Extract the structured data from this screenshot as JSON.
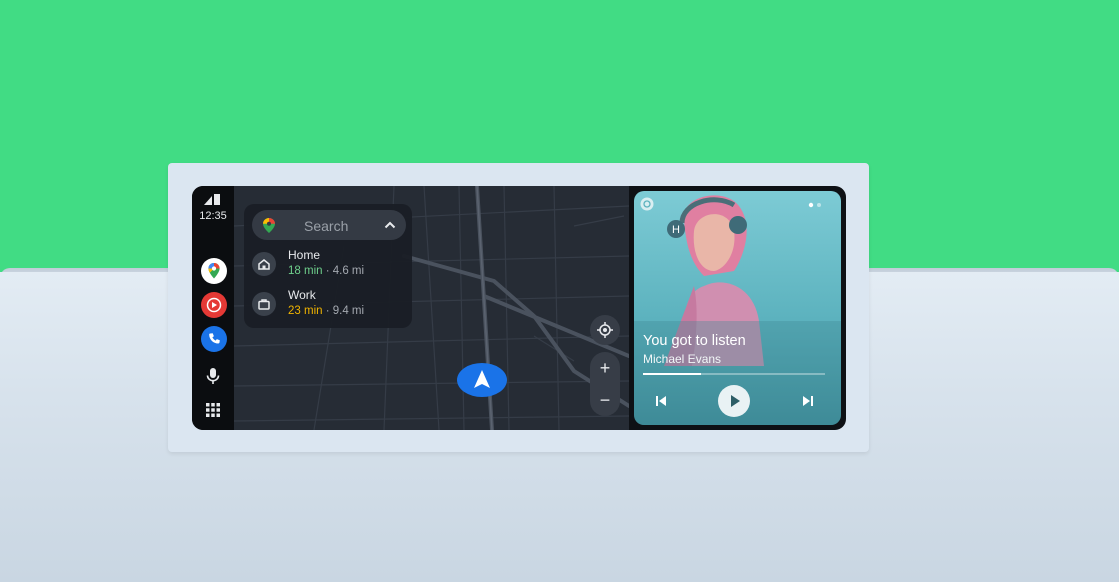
{
  "status": {
    "time": "12:35"
  },
  "rail": {
    "apps": [
      {
        "name": "Google Maps",
        "icon": "maps-icon",
        "color": "#ffffff"
      },
      {
        "name": "YouTube Music",
        "icon": "youtube-music-icon",
        "color": "#e53935"
      },
      {
        "name": "Phone",
        "icon": "phone-icon",
        "color": "#1a73e8"
      }
    ],
    "mic_icon": "microphone-icon",
    "launcher_icon": "app-grid-icon"
  },
  "nav": {
    "search_placeholder": "Search",
    "destinations": [
      {
        "name": "Home",
        "eta": "18 min",
        "distance": " · 4.6 mi",
        "eta_color": "#6fd08c",
        "icon": "home-icon"
      },
      {
        "name": "Work",
        "eta": "23 min",
        "distance": " · 9.4 mi",
        "eta_color": "#f0b400",
        "icon": "briefcase-icon"
      }
    ],
    "controls": {
      "recenter": "◎",
      "zoom_in": "+",
      "zoom_out": "−"
    }
  },
  "media": {
    "title": "You got to listen",
    "artist": "Michael Evans",
    "progress": 0.32,
    "page_dots": 2,
    "active_page": 1
  },
  "colors": {
    "background": "#41dc84",
    "accent": "#1a73e8"
  }
}
